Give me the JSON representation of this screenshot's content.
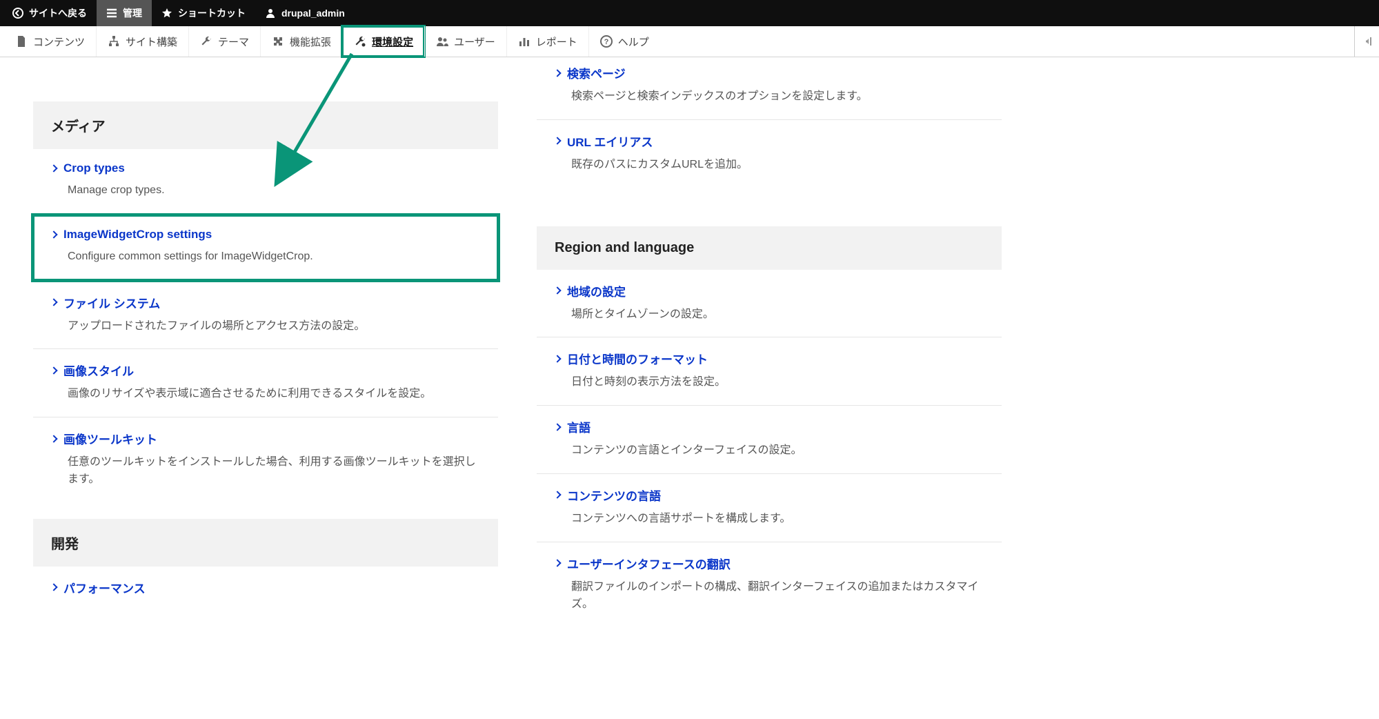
{
  "toolbar": {
    "back": "サイトへ戻る",
    "manage": "管理",
    "shortcuts": "ショートカット",
    "user": "drupal_admin"
  },
  "menubar": {
    "content": "コンテンツ",
    "structure": "サイト構築",
    "appearance": "テーマ",
    "extend": "機能拡張",
    "configuration": "環境設定",
    "people": "ユーザー",
    "reports": "レポート",
    "help": "ヘルプ"
  },
  "left": {
    "media_heading": "メディア",
    "crop_types": {
      "title": "Crop types",
      "desc": "Manage crop types."
    },
    "iwc": {
      "title": "ImageWidgetCrop settings",
      "desc": "Configure common settings for ImageWidgetCrop."
    },
    "file_system": {
      "title": "ファイル システム",
      "desc": "アップロードされたファイルの場所とアクセス方法の設定。"
    },
    "image_styles": {
      "title": "画像スタイル",
      "desc": "画像のリサイズや表示域に適合させるために利用できるスタイルを設定。"
    },
    "image_toolkit": {
      "title": "画像ツールキット",
      "desc": "任意のツールキットをインストールした場合、利用する画像ツールキットを選択します。"
    },
    "dev_heading": "開発",
    "performance": {
      "title": "パフォーマンス"
    }
  },
  "right": {
    "search_pages": {
      "title": "検索ページ",
      "desc": "検索ページと検索インデックスのオプションを設定します。"
    },
    "url_aliases": {
      "title": "URL エイリアス",
      "desc": "既存のパスにカスタムURLを追加。"
    },
    "region_heading": "Region and language",
    "regional": {
      "title": "地域の設定",
      "desc": "場所とタイムゾーンの設定。"
    },
    "date_time": {
      "title": "日付と時間のフォーマット",
      "desc": "日付と時刻の表示方法を設定。"
    },
    "language": {
      "title": "言語",
      "desc": "コンテンツの言語とインターフェイスの設定。"
    },
    "content_lang": {
      "title": "コンテンツの言語",
      "desc": "コンテンツへの言語サポートを構成します。"
    },
    "ui_translate": {
      "title": "ユーザーインタフェースの翻訳",
      "desc": "翻訳ファイルのインポートの構成、翻訳インターフェイスの追加またはカスタマイズ。"
    }
  }
}
